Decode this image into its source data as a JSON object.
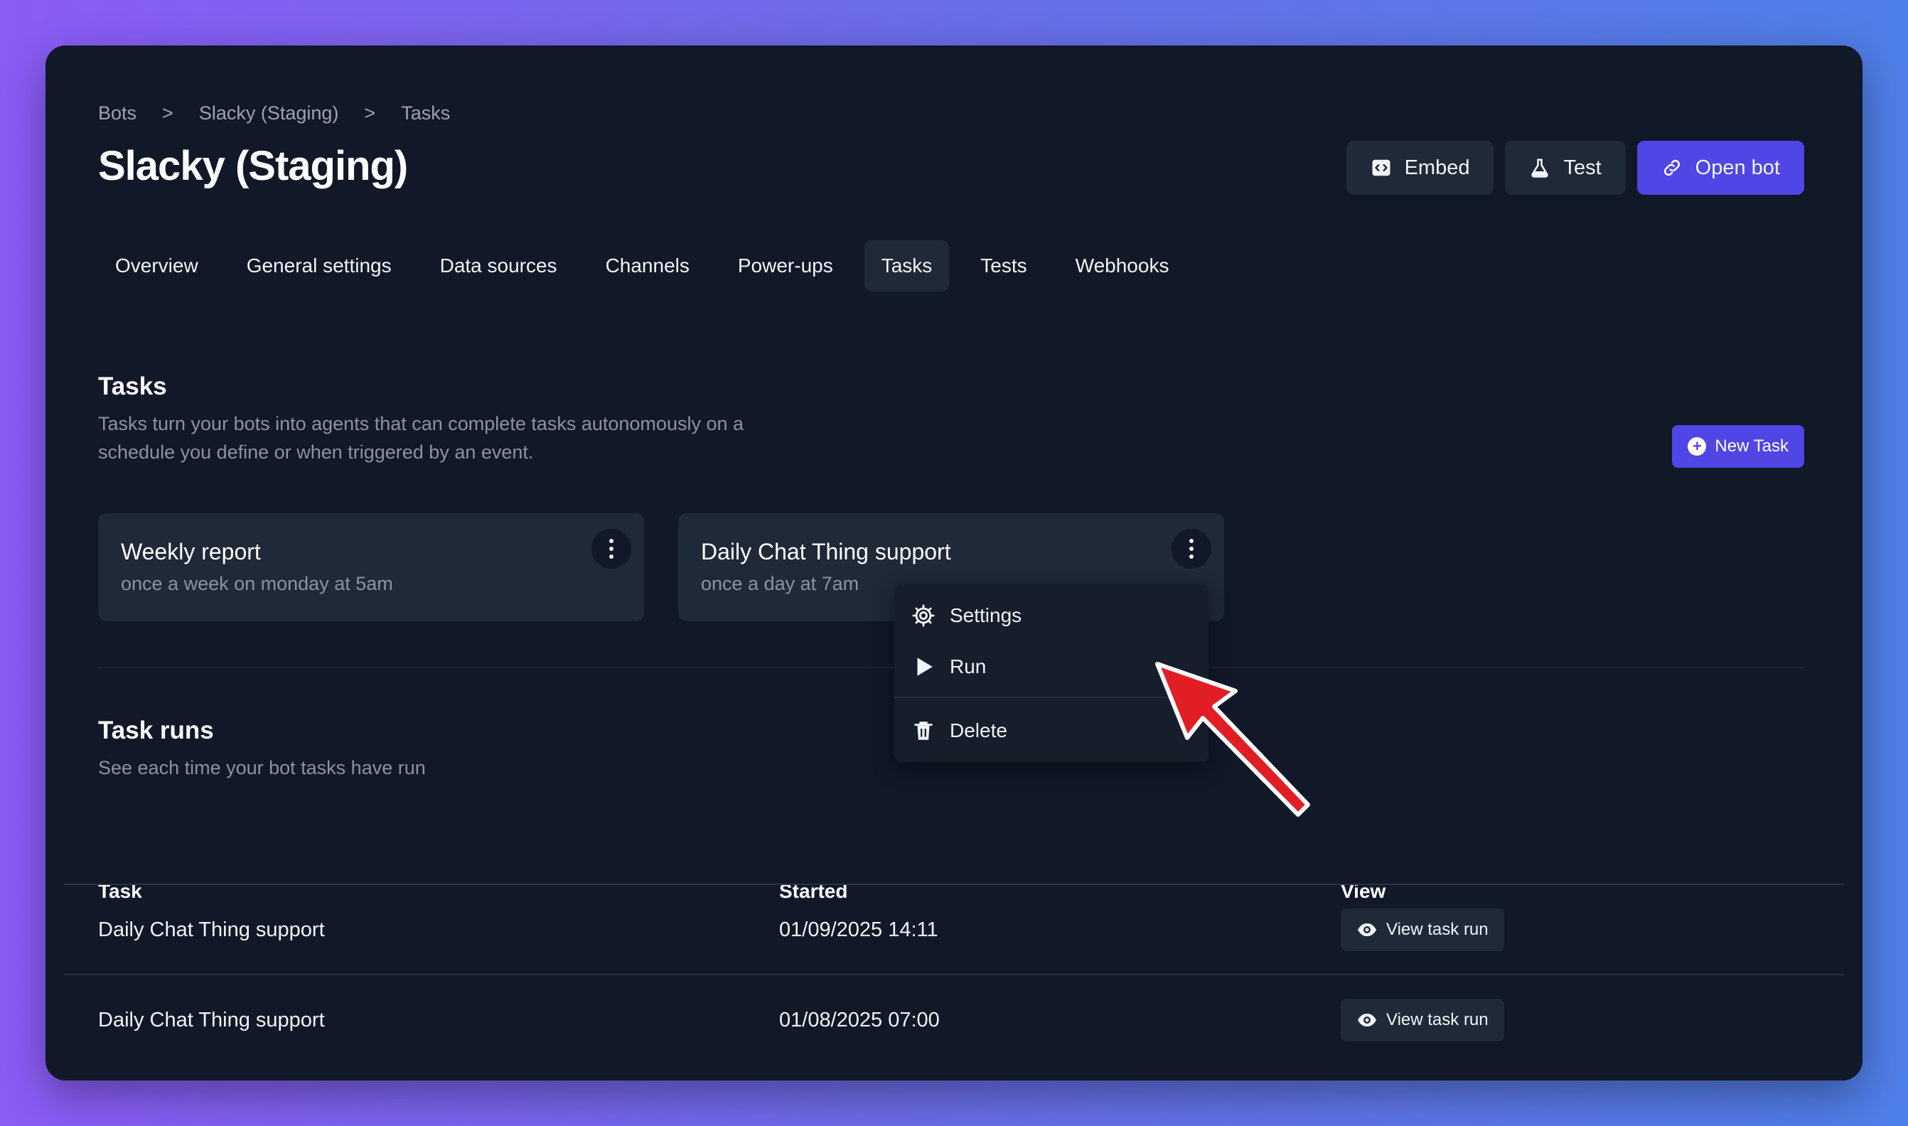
{
  "breadcrumb": [
    "Bots",
    "Slacky (Staging)",
    "Tasks"
  ],
  "breadcrumb_sep": ">",
  "page_title": "Slacky (Staging)",
  "header_actions": {
    "embed": "Embed",
    "test": "Test",
    "open_bot": "Open bot"
  },
  "tabs": [
    "Overview",
    "General settings",
    "Data sources",
    "Channels",
    "Power-ups",
    "Tasks",
    "Tests",
    "Webhooks"
  ],
  "active_tab": "Tasks",
  "tasks_section": {
    "title": "Tasks",
    "description_line1": "Tasks turn your bots into agents that can complete tasks autonomously on a",
    "description_line2": "schedule you define or when triggered by an event.",
    "new_task": "New Task"
  },
  "task_cards": [
    {
      "title": "Weekly report",
      "schedule": "once a week on monday at 5am"
    },
    {
      "title": "Daily Chat Thing support",
      "schedule": "once a day at 7am"
    }
  ],
  "context_menu": {
    "settings": "Settings",
    "run": "Run",
    "delete": "Delete"
  },
  "task_runs": {
    "title": "Task runs",
    "description": "See each time your bot tasks have run",
    "columns": {
      "task": "Task",
      "started": "Started",
      "view": "View"
    },
    "rows": [
      {
        "task": "Daily Chat Thing support",
        "started": "01/09/2025 14:11",
        "view": "View task run"
      },
      {
        "task": "Daily Chat Thing support",
        "started": "01/08/2025 07:00",
        "view": "View task run"
      }
    ]
  },
  "colors": {
    "accent": "#4f46e5",
    "window_bg": "#111827",
    "card_bg": "#1f2937",
    "annotation_arrow": "#e11d26"
  },
  "icons": [
    "embed-icon",
    "flask-icon",
    "link-icon",
    "plus-circle-icon",
    "kebab-menu-icon",
    "gear-icon",
    "play-icon",
    "trash-icon",
    "eye-icon"
  ]
}
